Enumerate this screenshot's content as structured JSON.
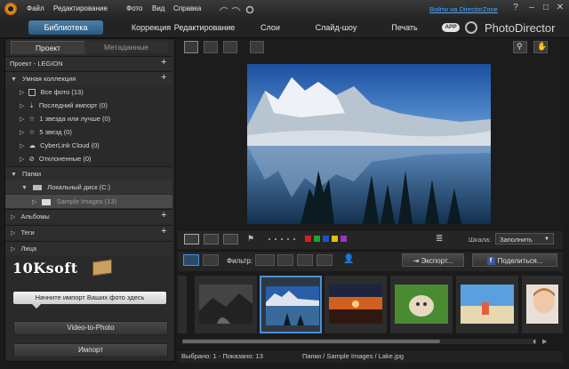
{
  "app": {
    "brand": "PhotoDirector",
    "app_badge": "APP"
  },
  "menu": [
    "Файл",
    "Редактирование",
    "Фото",
    "Вид",
    "Справка"
  ],
  "login_link": "Войти на DirectorZone",
  "window_controls": {
    "help": "?",
    "minimize": "–",
    "maximize": "□",
    "close": "✕"
  },
  "modes": [
    "Библиотека",
    "Коррекция",
    "Редактирование",
    "Слои",
    "Слайд-шоу",
    "Печать"
  ],
  "left_panel": {
    "tabs": [
      "Проект",
      "Метаданные"
    ],
    "project_title": "Проект - LEGION",
    "smart_collection": {
      "title": "Умная коллекция",
      "items": [
        "Все фото (13)",
        "Последний импорт (0)",
        "1 звезда или лучше (0)",
        "5 звезд (0)",
        "CyberLink Cloud (0)",
        "Отклоненные (0)"
      ]
    },
    "folders": {
      "title": "Папки",
      "disk": "Локальный диск (C:)",
      "folder": "Sample Images (13)"
    },
    "albums": "Альбомы",
    "tags": "Теги",
    "faces": "Лица",
    "watermark": "10Ksoft",
    "import_hint": "Начните импорт Ваших фото здесь",
    "buttons": {
      "video_to_photo": "Video-to-Photo",
      "import": "Импорт"
    }
  },
  "toolbar": {
    "filter_label": "Фильтр:",
    "scale_label": "Шкала:",
    "scale_value": "Заполнить",
    "export": "Экспорт...",
    "share": "Поделиться...",
    "fb_letter": "f"
  },
  "colors": {
    "accent": "#4a90d9",
    "tab_active": "#3d6e96",
    "labels": [
      "#d42020",
      "#22a030",
      "#2050d0",
      "#e0c000",
      "#a030c0"
    ]
  },
  "thumbnails": [
    "partial",
    "dark-landscape",
    "lake",
    "sunset",
    "cat",
    "beach",
    "child",
    "partial"
  ],
  "status": {
    "selected": "Выбрано: 1 - Показано: 13",
    "path": "Папки / Sample Images / Lake.jpg"
  }
}
